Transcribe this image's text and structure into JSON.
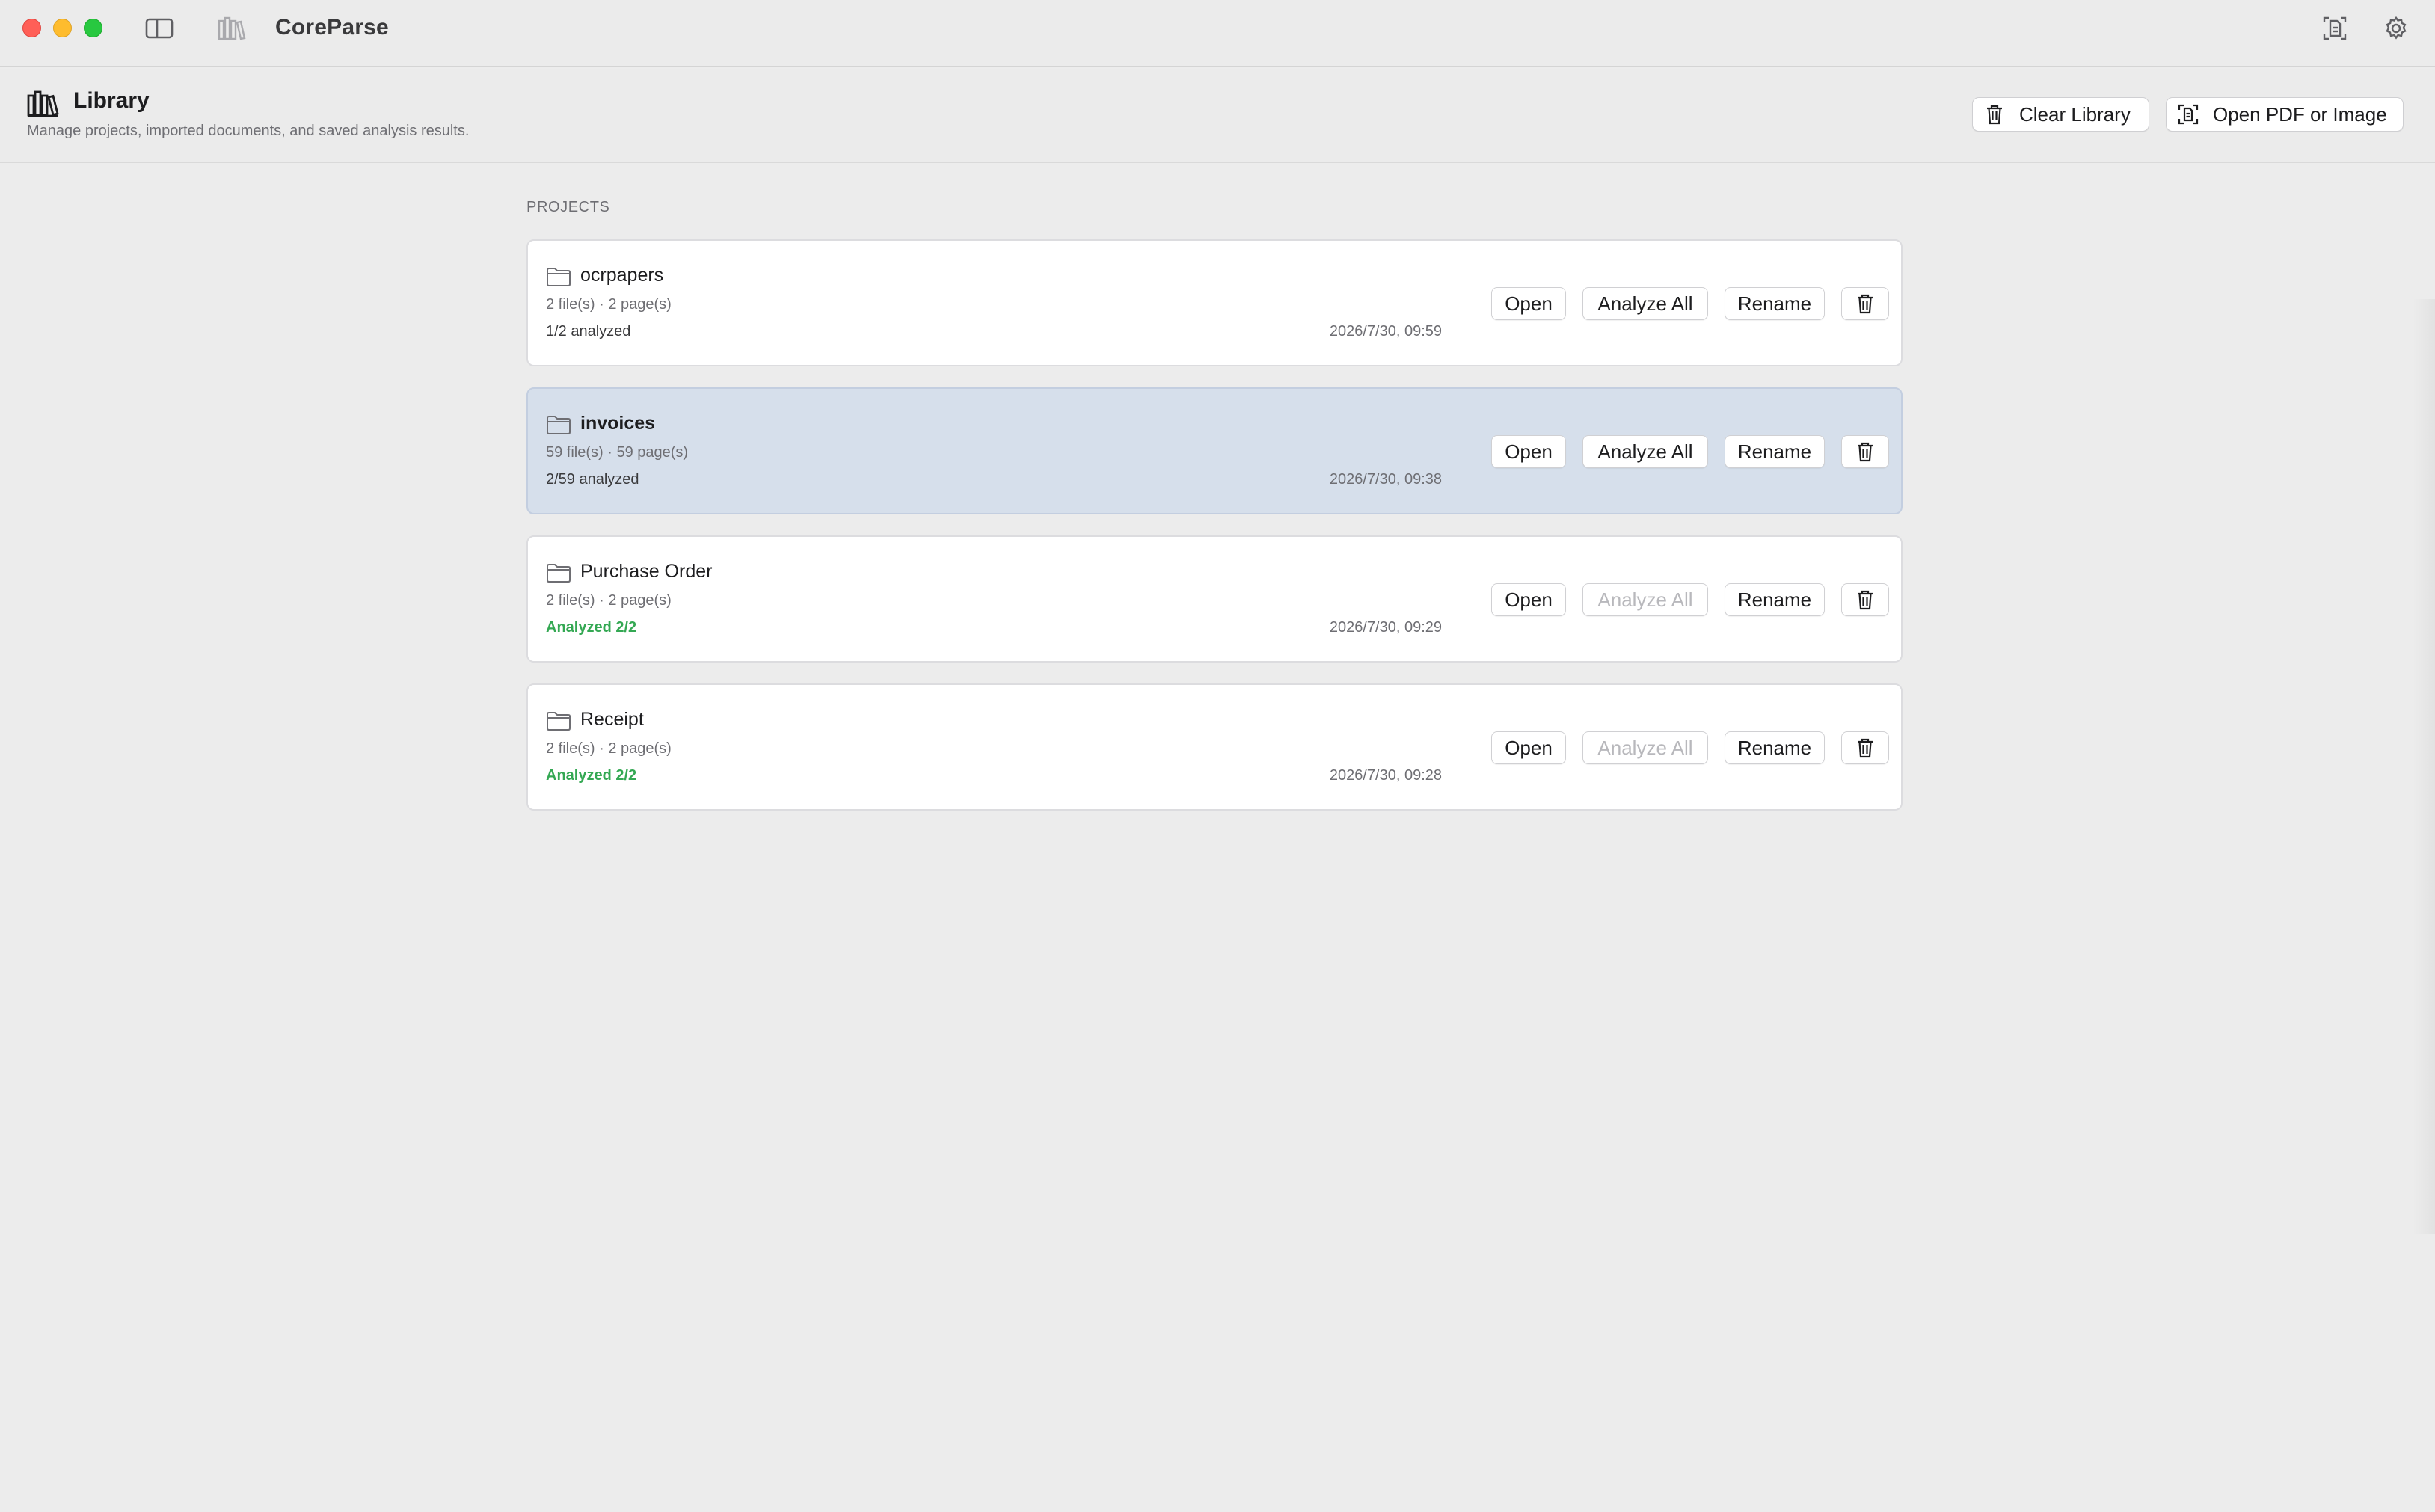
{
  "window": {
    "title": "CoreParse"
  },
  "header": {
    "title": "Library",
    "subtitle": "Manage projects, imported documents, and saved analysis results.",
    "clear_label": "Clear Library",
    "open_label": "Open PDF or Image"
  },
  "section": {
    "label": "PROJECTS"
  },
  "projects": [
    {
      "name": "ocrpapers",
      "meta": "2 file(s) · 2 page(s)",
      "status": "1/2 analyzed",
      "date": "2026/7/30, 09:59",
      "open_label": "Open",
      "analyze_label": "Analyze All",
      "rename_label": "Rename"
    },
    {
      "name": "invoices",
      "meta": "59 file(s) · 59 page(s)",
      "status": "2/59 analyzed",
      "date": "2026/7/30, 09:38",
      "open_label": "Open",
      "analyze_label": "Analyze All",
      "rename_label": "Rename"
    },
    {
      "name": "Purchase Order",
      "meta": "2 file(s) · 2 page(s)",
      "status": "Analyzed 2/2",
      "date": "2026/7/30, 09:29",
      "open_label": "Open",
      "analyze_label": "Analyze All",
      "rename_label": "Rename"
    },
    {
      "name": "Receipt",
      "meta": "2 file(s) · 2 page(s)",
      "status": "Analyzed 2/2",
      "date": "2026/7/30, 09:28",
      "open_label": "Open",
      "analyze_label": "Analyze All",
      "rename_label": "Rename"
    }
  ],
  "icons": {
    "sidebar_toggle": "sidebar-icon",
    "library": "books-icon",
    "scan": "document-scan-icon",
    "settings": "gear-icon",
    "folder": "folder-icon",
    "trash": "trash-icon"
  },
  "colors": {
    "selected_row": "#d6dfeb",
    "analyzed_green": "#34a853",
    "disabled_text": "#b8b8bc"
  }
}
